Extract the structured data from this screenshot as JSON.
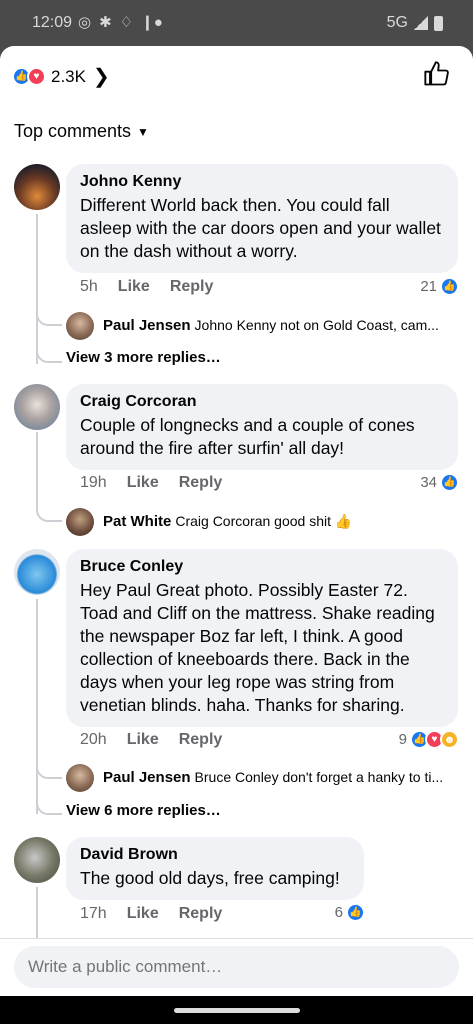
{
  "status": {
    "time": "12:09",
    "network": "5G"
  },
  "header": {
    "reaction_count": "2.3K",
    "reactions": [
      "like-icon",
      "love-icon"
    ]
  },
  "sort": {
    "label": "Top comments"
  },
  "comments": [
    {
      "name": "Johno Kenny",
      "text": "Different World back then. You could fall asleep with the car doors open and your wallet on the dash without a worry.",
      "time": "5h",
      "like": "Like",
      "reply": "Reply",
      "reaction_count": "21",
      "reply_preview": {
        "name": "Paul Jensen",
        "text": "Johno Kenny not on Gold Coast, cam..."
      },
      "view_more": "View 3 more replies…"
    },
    {
      "name": "Craig Corcoran",
      "text": "Couple of longnecks and a couple of cones around the fire after surfin' all day!",
      "time": "19h",
      "like": "Like",
      "reply": "Reply",
      "reaction_count": "34",
      "reply_preview": {
        "name": "Pat White",
        "text": "Craig Corcoran good shit 👍"
      }
    },
    {
      "name": "Bruce Conley",
      "text": "Hey Paul Great photo. Possibly Easter 72. Toad and Cliff on the mattress. Shake reading the newspaper Boz far left, I think. A good collection of kneeboards there. Back in the days when your leg rope was string from venetian blinds. haha. Thanks for sharing.",
      "time": "20h",
      "like": "Like",
      "reply": "Reply",
      "reaction_count": "9",
      "reply_preview": {
        "name": "Paul Jensen",
        "text": "Bruce Conley don't forget a hanky to ti..."
      },
      "view_more": "View 6 more replies…"
    },
    {
      "name": "David Brown",
      "text": "The good old days, free camping!",
      "time": "17h",
      "like": "Like",
      "reply": "Reply",
      "reaction_count": "6"
    }
  ],
  "composer": {
    "placeholder": "Write a public comment…"
  },
  "colors": {
    "accent": "#1877f2",
    "bubble": "#f0f2f5",
    "love": "#f33e58",
    "haha": "#f7b125"
  }
}
